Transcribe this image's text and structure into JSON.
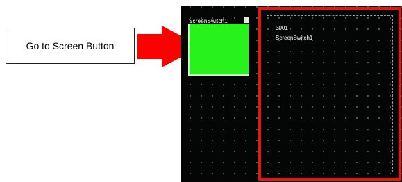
{
  "callout": {
    "label": "Go to Screen Button"
  },
  "arrow": {
    "icon": "right-arrow-icon",
    "color": "#ff0000"
  },
  "editor": {
    "switch": {
      "label": "ScreenSwitch1",
      "color": "#27f21c"
    },
    "target_screen": {
      "number": "3001",
      "name": "ScreenSwitch1",
      "highlight_color": "#e81414"
    }
  }
}
